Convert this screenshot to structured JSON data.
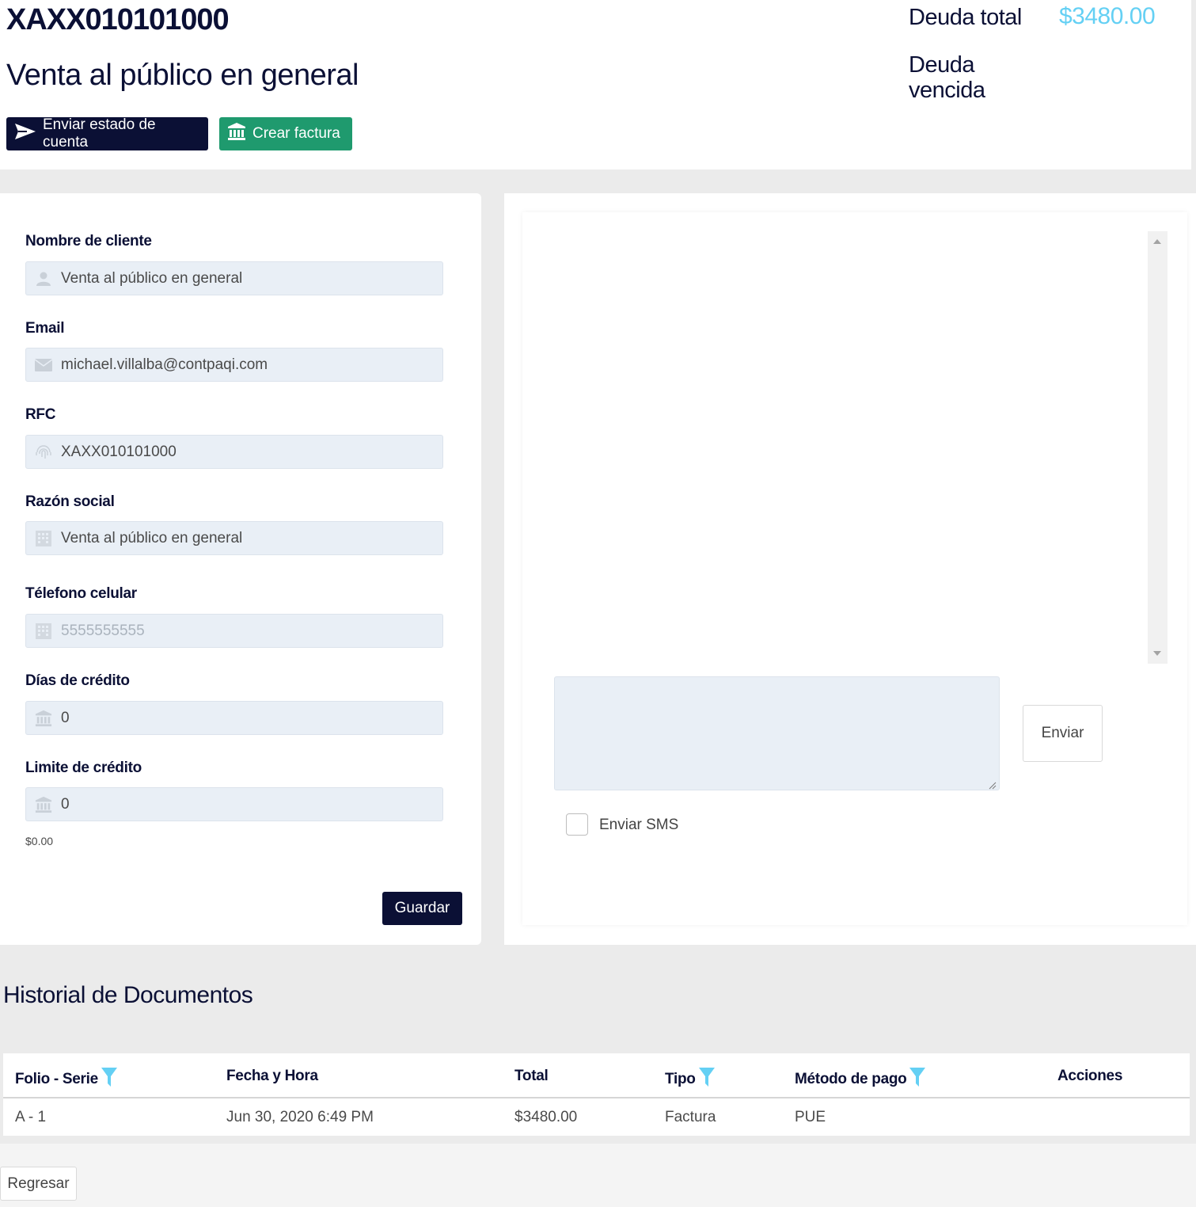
{
  "header": {
    "rfc": "XAXX010101000",
    "client_name": "Venta al público en general",
    "send_statement_label": "Enviar estado de cuenta",
    "create_invoice_label": "Crear factura",
    "debt_total_label": "Deuda total",
    "debt_total_value": "$3480.00",
    "debt_overdue_label": "Deuda vencida"
  },
  "form": {
    "fields": [
      {
        "label": "Nombre de cliente",
        "value": "Venta al público en general",
        "icon": "user-icon"
      },
      {
        "label": "Email",
        "value": "michael.villalba@contpaqi.com",
        "icon": "envelope-icon"
      },
      {
        "label": "RFC",
        "value": "XAXX010101000",
        "icon": "fingerprint-icon"
      },
      {
        "label": "Razón social",
        "value": "Venta al público en general",
        "icon": "building-icon"
      },
      {
        "label": "Télefono celular",
        "placeholder": "5555555555",
        "value": "",
        "icon": "building-icon"
      },
      {
        "label": "Días de crédito",
        "value": "0",
        "icon": "bank-icon"
      },
      {
        "label": "Limite de crédito",
        "value": "0",
        "icon": "bank-icon"
      }
    ],
    "credit_hint": "$0.00",
    "save_label": "Guardar"
  },
  "messages": {
    "send_label": "Enviar",
    "sms_label": "Enviar SMS",
    "sms_checked": false
  },
  "history": {
    "title": "Historial de Documentos",
    "columns": [
      "Folio - Serie",
      "Fecha y Hora",
      "Total",
      "Tipo",
      "Método de pago",
      "Acciones"
    ],
    "rows": [
      {
        "folio": "A  -  1",
        "fecha": "Jun 30, 2020 6:49 PM",
        "total": "$3480.00",
        "tipo": "Factura",
        "metodo": "PUE",
        "acciones": ""
      }
    ]
  },
  "footer": {
    "back_label": "Regresar"
  },
  "colors": {
    "navy": "#0b1035",
    "green": "#1f9a6e",
    "accent": "#64d0f4"
  }
}
